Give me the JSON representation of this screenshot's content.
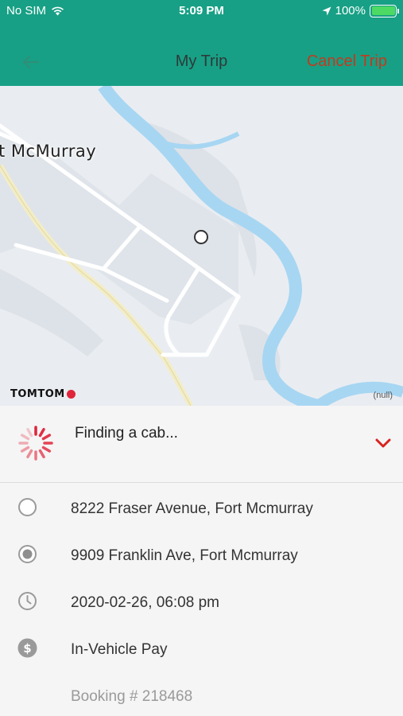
{
  "status_bar": {
    "carrier": "No SIM",
    "time": "5:09 PM",
    "battery": "100%",
    "battery_level": 1.0,
    "icons": [
      "wifi-icon",
      "location-arrow-icon",
      "battery-icon"
    ]
  },
  "nav": {
    "back_icon": "arrow-left-icon",
    "title": "My Trip",
    "cancel_label": "Cancel Trip"
  },
  "map": {
    "place_label": "t McMurray",
    "provider_logo": "TOMTOM",
    "attribution": "(null)"
  },
  "status_panel": {
    "message": "Finding a cab...",
    "spinner_icon": "loading-spinner-icon",
    "toggle_icon": "chevron-down-icon"
  },
  "trip": {
    "pickup": "8222 Fraser Avenue, Fort Mcmurray",
    "dropoff": "9909 Franklin Ave, Fort Mcmurray",
    "datetime": "2020-02-26, 06:08 pm",
    "payment": "In-Vehicle Pay",
    "booking": "Booking # 218468"
  },
  "colors": {
    "header": "#17a085",
    "cancel": "#c23a1f",
    "accent_red": "#e0243a",
    "river": "#a7d6f2",
    "map_bg": "#e9edf1"
  }
}
